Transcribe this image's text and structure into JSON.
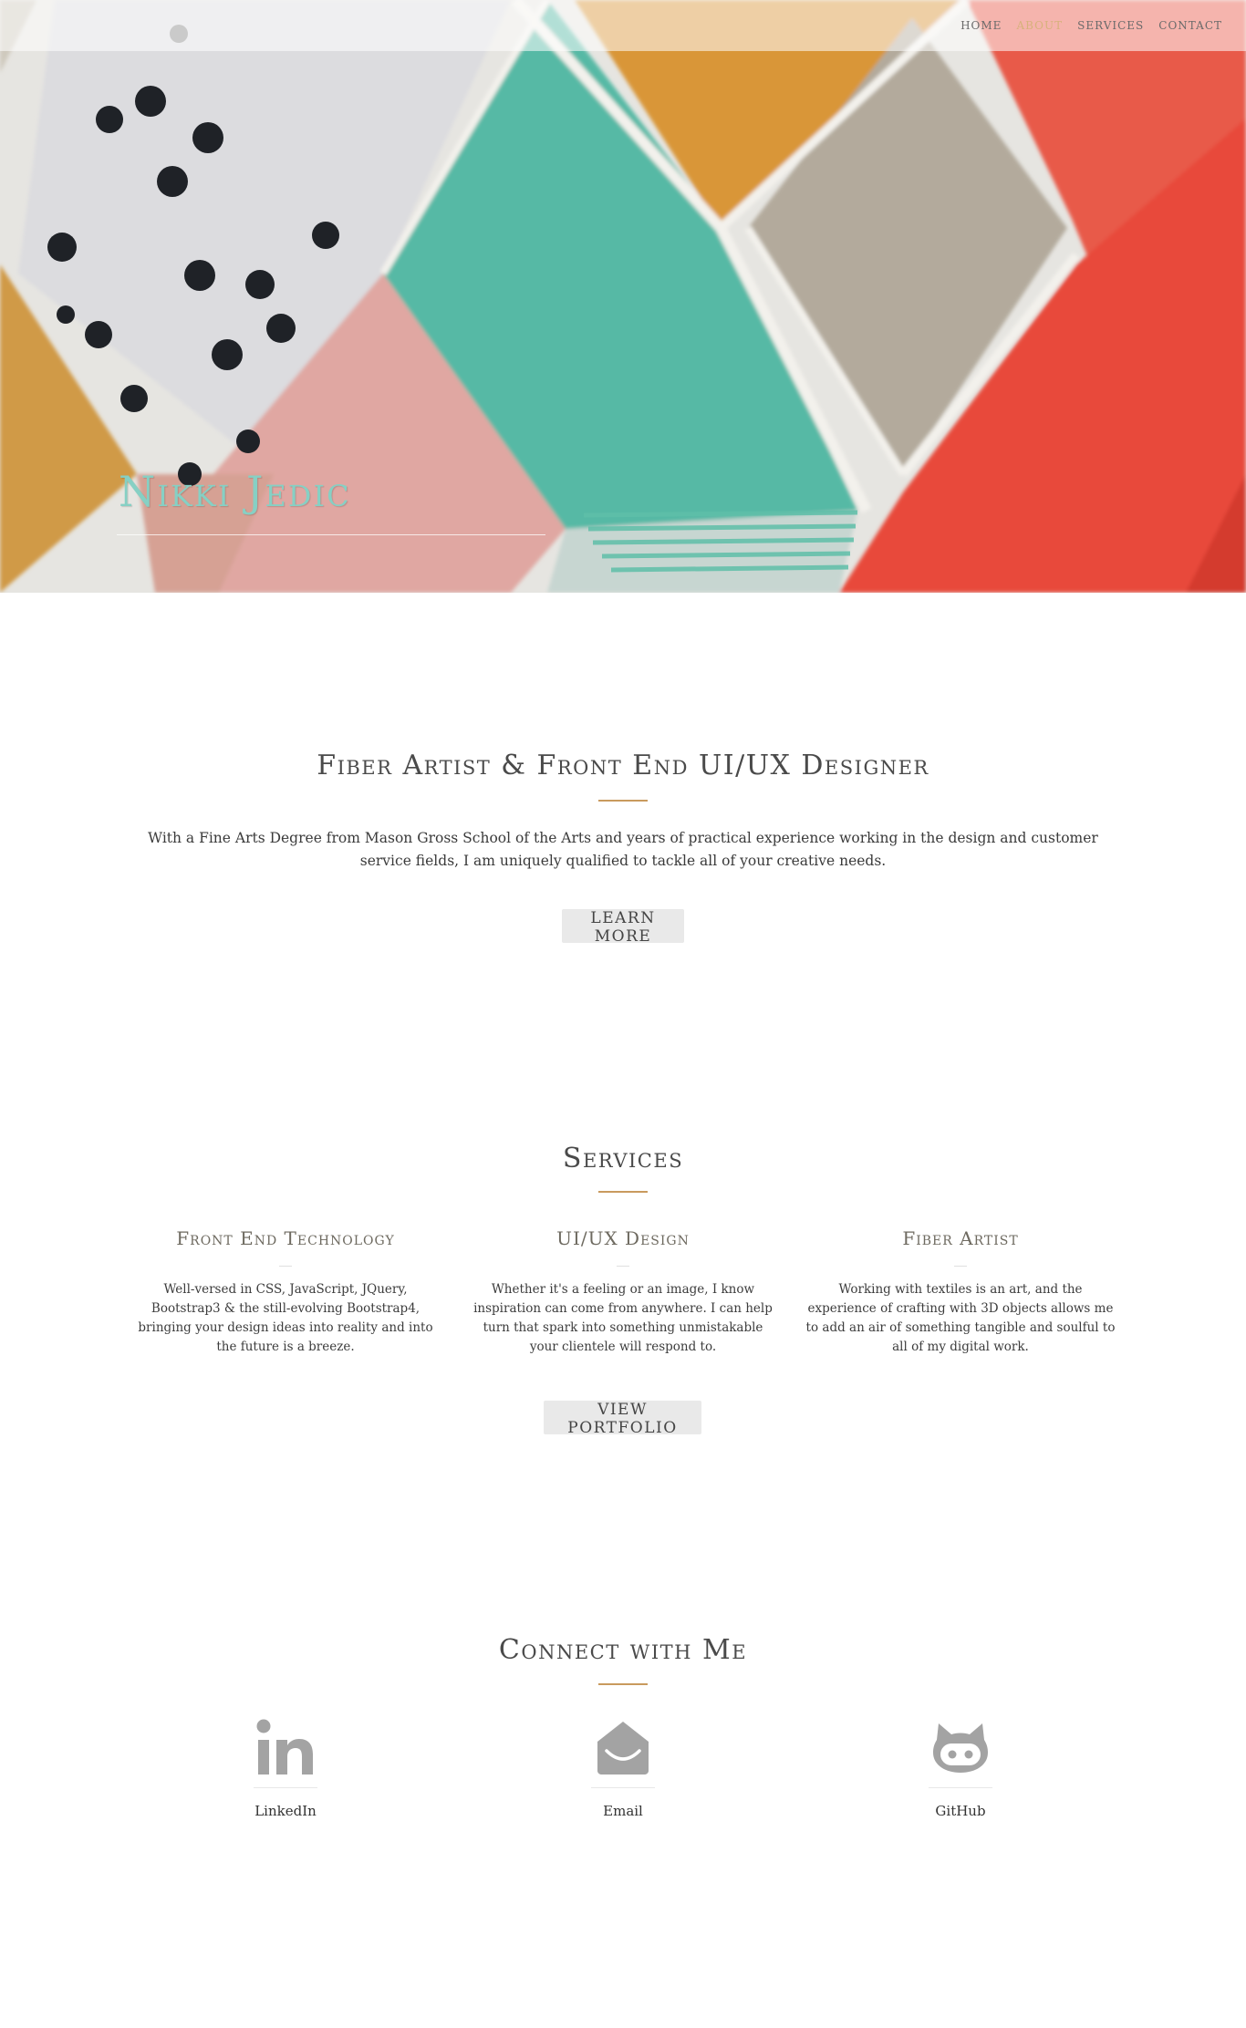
{
  "nav": {
    "items": [
      {
        "label": "HOME"
      },
      {
        "label": "ABOUT"
      },
      {
        "label": "SERVICES"
      },
      {
        "label": "CONTACT"
      }
    ],
    "active_color": "#d7b27c"
  },
  "hero": {
    "title": "Nikki Jedic"
  },
  "about": {
    "heading": "Fiber Artist & Front End UI/UX Designer",
    "text": "With a Fine Arts Degree from Mason Gross School of the Arts and years of practical experience working in the design and customer service fields, I am uniquely qualified to tackle all of your creative needs.",
    "button": "LEARN MORE"
  },
  "services": {
    "heading": "Services",
    "items": [
      {
        "title": "Front End Technology",
        "text": "Well-versed in CSS, JavaScript, JQuery, Bootstrap3 & the still-evolving Bootstrap4, bringing your design ideas into reality and into the future is a breeze."
      },
      {
        "title": "UI/UX Design",
        "text": "Whether it's a feeling or an image, I know inspiration can come from anywhere. I can help turn that spark into something unmistakable your clientele will respond to."
      },
      {
        "title": "Fiber Artist",
        "text": "Working with textiles is an art, and the experience of crafting with 3D objects allows me to add an air of something tangible and soulful to all of my digital work."
      }
    ],
    "button": "VIEW PORTFOLIO"
  },
  "connect": {
    "heading": "Connect with Me",
    "items": [
      {
        "label": "LinkedIn",
        "icon": "linkedin-icon"
      },
      {
        "label": "Email",
        "icon": "email-icon"
      },
      {
        "label": "GitHub",
        "icon": "github-icon"
      }
    ]
  },
  "colors": {
    "accent": "#c99a5e",
    "teal": "#86d0c4",
    "button_bg": "#e9e9e9",
    "icon_gray": "#a3a3a3"
  }
}
